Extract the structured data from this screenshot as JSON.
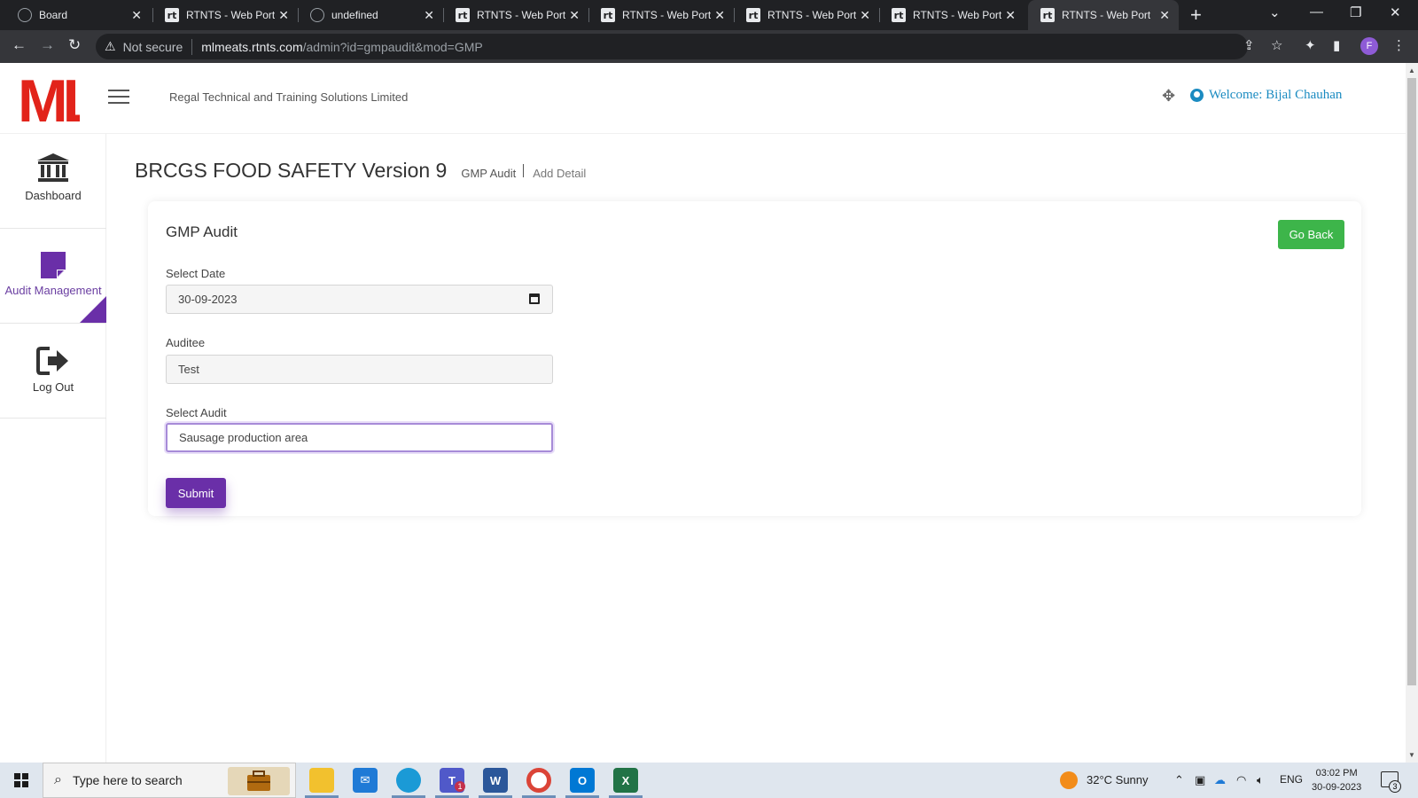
{
  "browser": {
    "tabs": [
      {
        "title": "Board",
        "icon": "globe-icon"
      },
      {
        "title": "RTNTS - Web Port",
        "icon": "rt-favicon"
      },
      {
        "title": "undefined",
        "icon": "globe-icon"
      },
      {
        "title": "RTNTS - Web Port",
        "icon": "rt-favicon"
      },
      {
        "title": "RTNTS - Web Port",
        "icon": "rt-favicon"
      },
      {
        "title": "RTNTS - Web Port",
        "icon": "rt-favicon"
      },
      {
        "title": "RTNTS - Web Port",
        "icon": "rt-favicon"
      },
      {
        "title": "RTNTS - Web Port",
        "icon": "rt-favicon",
        "active": true
      }
    ],
    "security_label": "Not secure",
    "url_host": "mlmeats.rtnts.com",
    "url_path": "/admin?id=gmpaudit&mod=GMP",
    "profile_initial": "F"
  },
  "header": {
    "logo_text": "ML",
    "company": "Regal Technical and Training Solutions Limited",
    "welcome": "Welcome: Bijal Chauhan"
  },
  "sidebar": {
    "items": [
      {
        "label": "Dashboard",
        "icon": "bank-icon"
      },
      {
        "label": "Audit Management",
        "icon": "note-icon",
        "active": true
      },
      {
        "label": "Log Out",
        "icon": "sign-out-icon"
      }
    ]
  },
  "main": {
    "title": "BRCGS FOOD SAFETY Version 9",
    "breadcrumb": [
      "GMP Audit",
      "Add Detail"
    ],
    "card_title": "GMP Audit",
    "go_back": "Go Back",
    "fields": {
      "date_label": "Select Date",
      "date_value": "30-09-2023",
      "auditee_label": "Auditee",
      "auditee_value": "Test",
      "audit_label": "Select Audit",
      "audit_value": "Sausage production area"
    },
    "submit": "Submit"
  },
  "taskbar": {
    "search_placeholder": "Type here to search",
    "weather": "32°C  Sunny",
    "lang": "ENG",
    "time": "03:02 PM",
    "date": "30-09-2023",
    "notification_count": "3",
    "teams_badge": "1"
  },
  "colors": {
    "accent": "#6a2fa8",
    "success": "#3db54a",
    "link": "#1b8bc1",
    "logo_red": "#e2231a"
  }
}
